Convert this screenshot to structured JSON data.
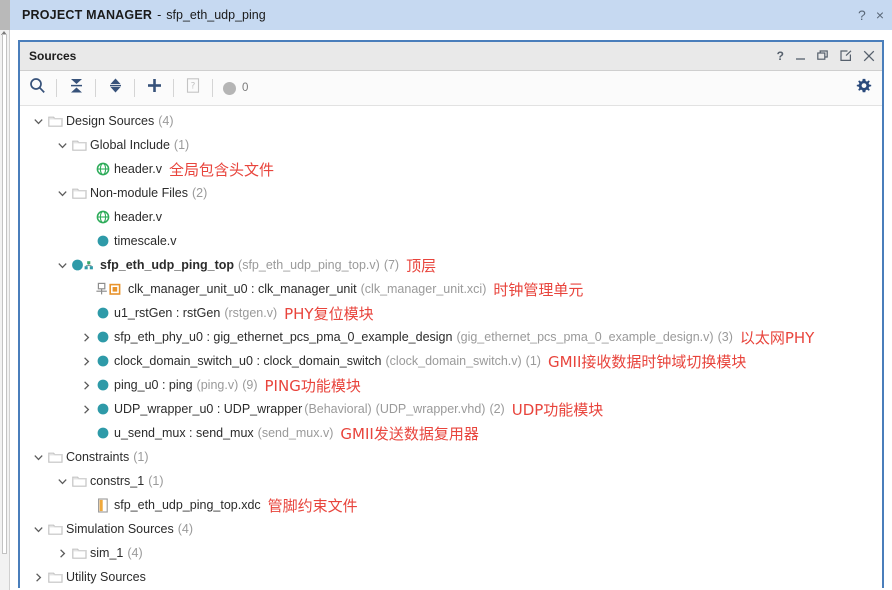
{
  "titlebar": {
    "app_label": "PROJECT MANAGER",
    "separator": "-",
    "project_name": "sfp_eth_udp_ping",
    "help_icon": "?",
    "close_icon": "×"
  },
  "panel": {
    "title": "Sources",
    "buttons": [
      {
        "name": "help",
        "glyph": "?"
      },
      {
        "name": "minimize",
        "glyph": "—"
      },
      {
        "name": "restore",
        "glyph": "restore-icon"
      },
      {
        "name": "float",
        "glyph": "float-icon"
      },
      {
        "name": "close",
        "glyph": "×"
      }
    ]
  },
  "toolbar": {
    "items": [
      {
        "name": "search",
        "tip": "Search"
      },
      {
        "name": "collapse-all",
        "tip": "Collapse All"
      },
      {
        "name": "expand-all",
        "tip": "Expand All"
      },
      {
        "name": "add-sources",
        "tip": "Add Sources"
      },
      {
        "name": "help",
        "tip": "Help"
      }
    ],
    "badge_count": "0",
    "settings_tip": "Settings"
  },
  "tree": {
    "rows": [
      {
        "indent": 0,
        "twisty": "down",
        "icon": "folder",
        "label": "Design Sources",
        "count": "(4)",
        "sub": "",
        "paren": "",
        "annot": "",
        "bold": false
      },
      {
        "indent": 1,
        "twisty": "down",
        "icon": "folder",
        "label": "Global Include",
        "count": "(1)",
        "sub": "",
        "paren": "",
        "annot": "",
        "bold": false
      },
      {
        "indent": 2,
        "twisty": "none",
        "icon": "globe-green",
        "label": "header.v",
        "count": "",
        "sub": "",
        "paren": "",
        "annot": "全局包含头文件",
        "bold": false
      },
      {
        "indent": 1,
        "twisty": "down",
        "icon": "folder",
        "label": "Non-module Files",
        "count": "(2)",
        "sub": "",
        "paren": "",
        "annot": "",
        "bold": false
      },
      {
        "indent": 2,
        "twisty": "none",
        "icon": "globe-green",
        "label": "header.v",
        "count": "",
        "sub": "",
        "paren": "",
        "annot": "",
        "bold": false
      },
      {
        "indent": 2,
        "twisty": "none",
        "icon": "circle-teal",
        "label": "timescale.v",
        "count": "",
        "sub": "",
        "paren": "",
        "annot": "",
        "bold": false
      },
      {
        "indent": 1,
        "twisty": "down",
        "icon": "circle-teal-hier",
        "label": "sfp_eth_udp_ping_top",
        "count": "(7)",
        "sub": "",
        "paren": "(sfp_eth_udp_ping_top.v)",
        "annot": "顶层",
        "bold": true
      },
      {
        "indent": 2,
        "twisty": "none",
        "icon": "ip-orange",
        "label": "clk_manager_unit_u0 : clk_manager_unit",
        "count": "",
        "sub": "",
        "paren": "(clk_manager_unit.xci)",
        "annot": "时钟管理单元",
        "bold": false
      },
      {
        "indent": 2,
        "twisty": "none",
        "icon": "circle-teal",
        "label": "u1_rstGen : rstGen",
        "count": "",
        "sub": "",
        "paren": "(rstgen.v)",
        "annot": "PHY复位模块",
        "bold": false
      },
      {
        "indent": 2,
        "twisty": "right",
        "icon": "circle-teal",
        "label": "sfp_eth_phy_u0 : gig_ethernet_pcs_pma_0_example_design",
        "count": "(3)",
        "sub": "",
        "paren": "(gig_ethernet_pcs_pma_0_example_design.v)",
        "annot": "以太网PHY",
        "bold": false
      },
      {
        "indent": 2,
        "twisty": "right",
        "icon": "circle-teal",
        "label": "clock_domain_switch_u0 : clock_domain_switch",
        "count": "(1)",
        "sub": "",
        "paren": "(clock_domain_switch.v)",
        "annot": "GMII接收数据时钟域切换模块",
        "bold": false
      },
      {
        "indent": 2,
        "twisty": "right",
        "icon": "circle-teal",
        "label": "ping_u0 : ping",
        "count": "(9)",
        "sub": "",
        "paren": "(ping.v)",
        "annot": "PING功能模块",
        "bold": false
      },
      {
        "indent": 2,
        "twisty": "right",
        "icon": "circle-teal",
        "label": "UDP_wrapper_u0 : UDP_wrapper",
        "count": "(2)",
        "sub": "(Behavioral)",
        "paren": "(UDP_wrapper.vhd)",
        "annot": "UDP功能模块",
        "bold": false
      },
      {
        "indent": 2,
        "twisty": "none",
        "icon": "circle-teal",
        "label": "u_send_mux : send_mux",
        "count": "",
        "sub": "",
        "paren": "(send_mux.v)",
        "annot": "GMII发送数据复用器",
        "bold": false
      },
      {
        "indent": 0,
        "twisty": "down",
        "icon": "folder",
        "label": "Constraints",
        "count": "(1)",
        "sub": "",
        "paren": "",
        "annot": "",
        "bold": false
      },
      {
        "indent": 1,
        "twisty": "down",
        "icon": "folder",
        "label": "constrs_1",
        "count": "(1)",
        "sub": "",
        "paren": "",
        "annot": "",
        "bold": false
      },
      {
        "indent": 2,
        "twisty": "none",
        "icon": "xdc-doc",
        "label": "sfp_eth_udp_ping_top.xdc",
        "count": "",
        "sub": "",
        "paren": "",
        "annot": "管脚约束文件",
        "bold": false
      },
      {
        "indent": 0,
        "twisty": "down",
        "icon": "folder",
        "label": "Simulation Sources",
        "count": "(4)",
        "sub": "",
        "paren": "",
        "annot": "",
        "bold": false
      },
      {
        "indent": 1,
        "twisty": "right",
        "icon": "folder",
        "label": "sim_1",
        "count": "(4)",
        "sub": "",
        "paren": "",
        "annot": "",
        "bold": false
      },
      {
        "indent": 0,
        "twisty": "right",
        "icon": "folder",
        "label": "Utility Sources",
        "count": "",
        "sub": "",
        "paren": "",
        "annot": "",
        "bold": false
      }
    ]
  },
  "colors": {
    "title_bg": "#c6d9f1",
    "panel_border": "#4a7ebb",
    "annotation_red": "#e8443c",
    "module_teal": "#2e9aa8",
    "include_green": "#2eac5a",
    "ip_orange": "#e8932c",
    "muted_gray": "#9a9a9a"
  }
}
